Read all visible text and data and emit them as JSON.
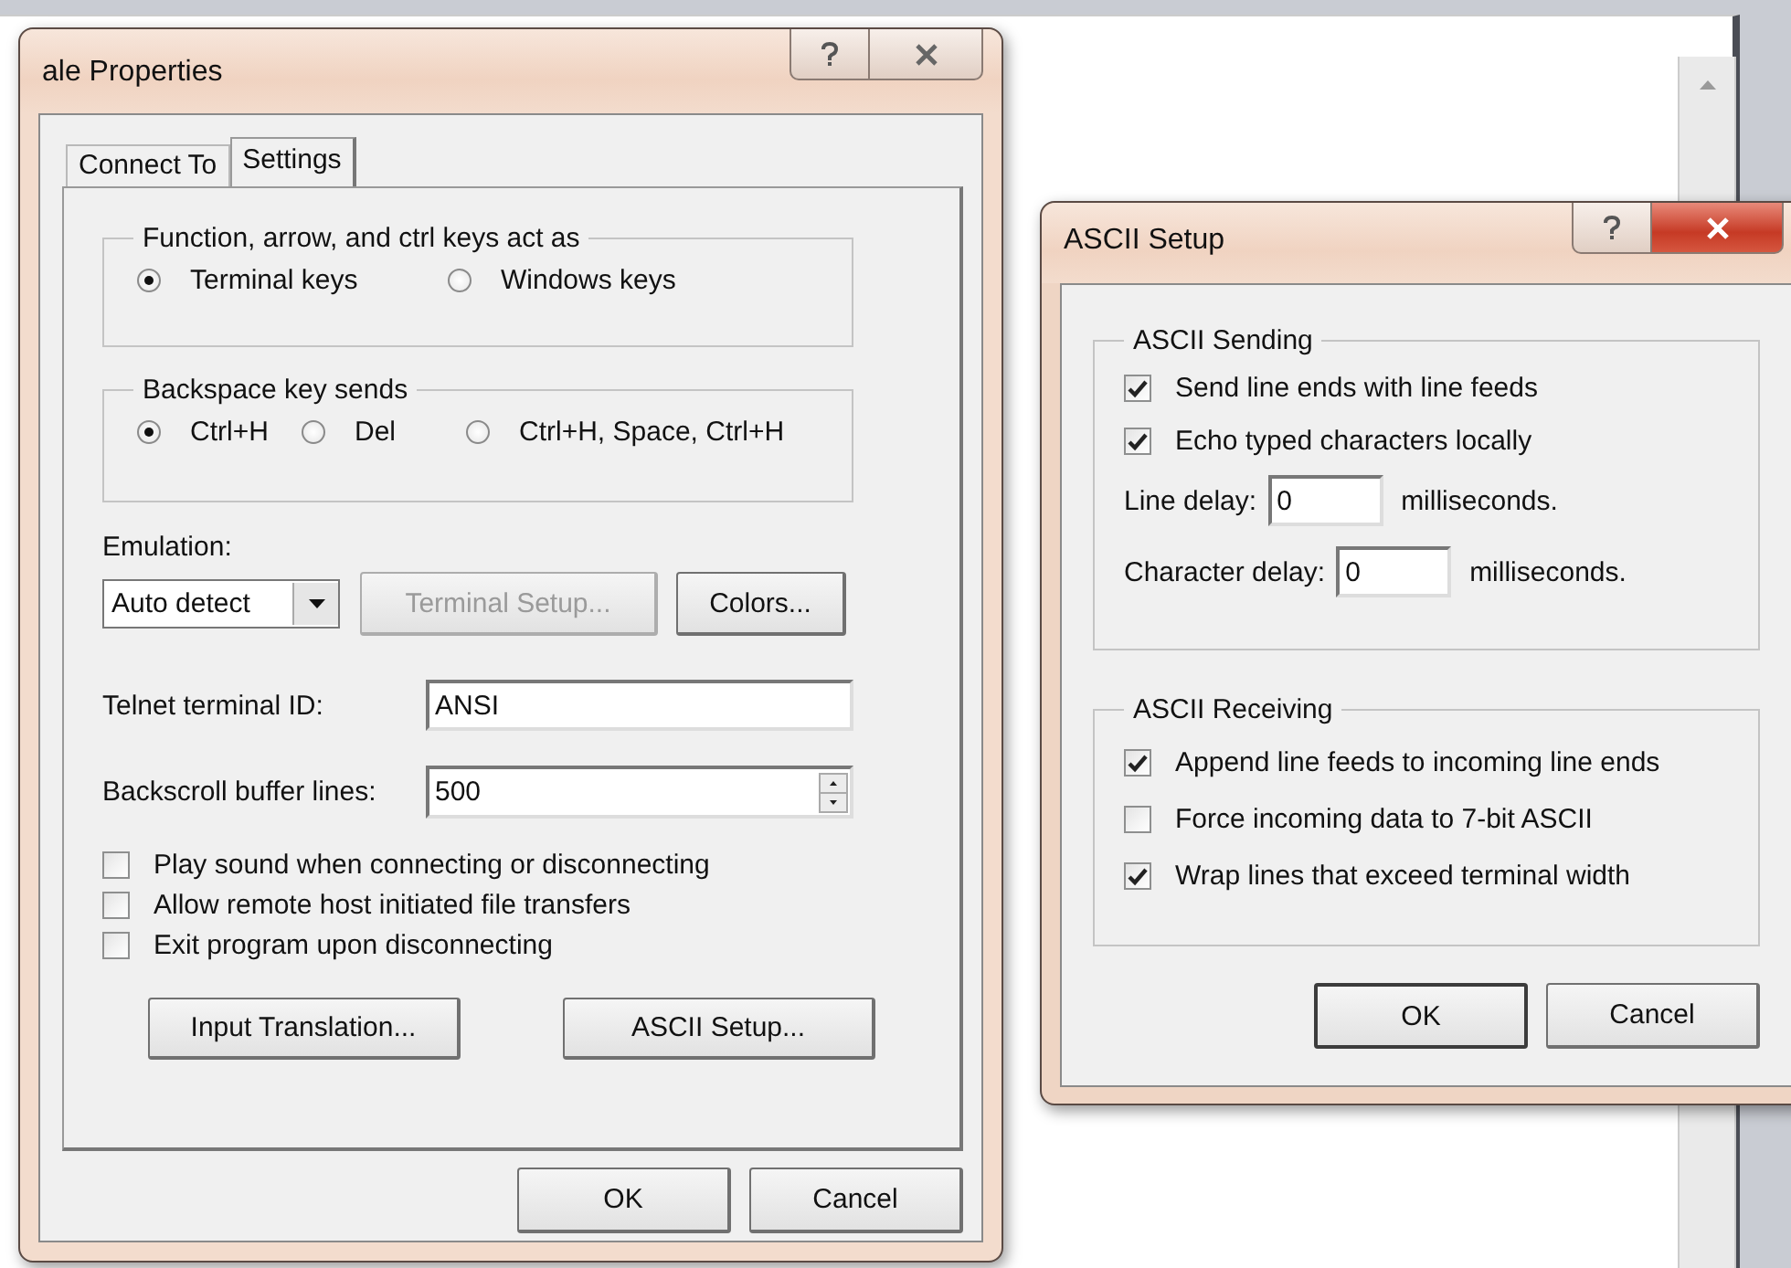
{
  "properties_dialog": {
    "title": "ale Properties",
    "tabs": [
      {
        "label": "Connect To",
        "selected": false
      },
      {
        "label": "Settings",
        "selected": true
      }
    ],
    "keys_group": {
      "legend": "Function, arrow, and ctrl keys act as",
      "options": [
        {
          "label": "Terminal keys",
          "selected": true
        },
        {
          "label": "Windows keys",
          "selected": false
        }
      ]
    },
    "backspace_group": {
      "legend": "Backspace key sends",
      "options": [
        {
          "label": "Ctrl+H",
          "selected": true
        },
        {
          "label": "Del",
          "selected": false
        },
        {
          "label": "Ctrl+H, Space, Ctrl+H",
          "selected": false
        }
      ]
    },
    "emulation": {
      "label": "Emulation:",
      "value": "Auto detect"
    },
    "emulation_buttons": [
      {
        "label": "Terminal Setup...",
        "disabled": true
      },
      {
        "label": "Colors...",
        "disabled": false
      }
    ],
    "telnet_id": {
      "label": "Telnet terminal ID:",
      "value": "ANSI"
    },
    "backscroll": {
      "label": "Backscroll buffer lines:",
      "value": "500"
    },
    "options": [
      {
        "label": "Play sound when connecting or disconnecting",
        "checked": false
      },
      {
        "label": "Allow remote host initiated file transfers",
        "checked": false
      },
      {
        "label": "Exit program upon disconnecting",
        "checked": false
      }
    ],
    "action_buttons": [
      "Input Translation...",
      "ASCII Setup..."
    ],
    "buttons": [
      "OK",
      "Cancel"
    ]
  },
  "ascii_dialog": {
    "title": "ASCII Setup",
    "sending": {
      "legend": "ASCII Sending",
      "options": [
        {
          "label": "Send line ends with line feeds",
          "checked": true
        },
        {
          "label": "Echo typed characters locally",
          "checked": true
        }
      ],
      "delays": [
        {
          "label": "Line delay:",
          "value": "0",
          "unit": "milliseconds."
        },
        {
          "label": "Character delay:",
          "value": "0",
          "unit": "milliseconds."
        }
      ]
    },
    "receiving": {
      "legend": "ASCII Receiving",
      "options": [
        {
          "label": "Append line feeds to incoming line ends",
          "checked": true
        },
        {
          "label": "Force incoming data to 7-bit ASCII",
          "checked": false
        },
        {
          "label": "Wrap lines that exceed terminal width",
          "checked": true
        }
      ]
    },
    "buttons": [
      "OK",
      "Cancel"
    ]
  }
}
